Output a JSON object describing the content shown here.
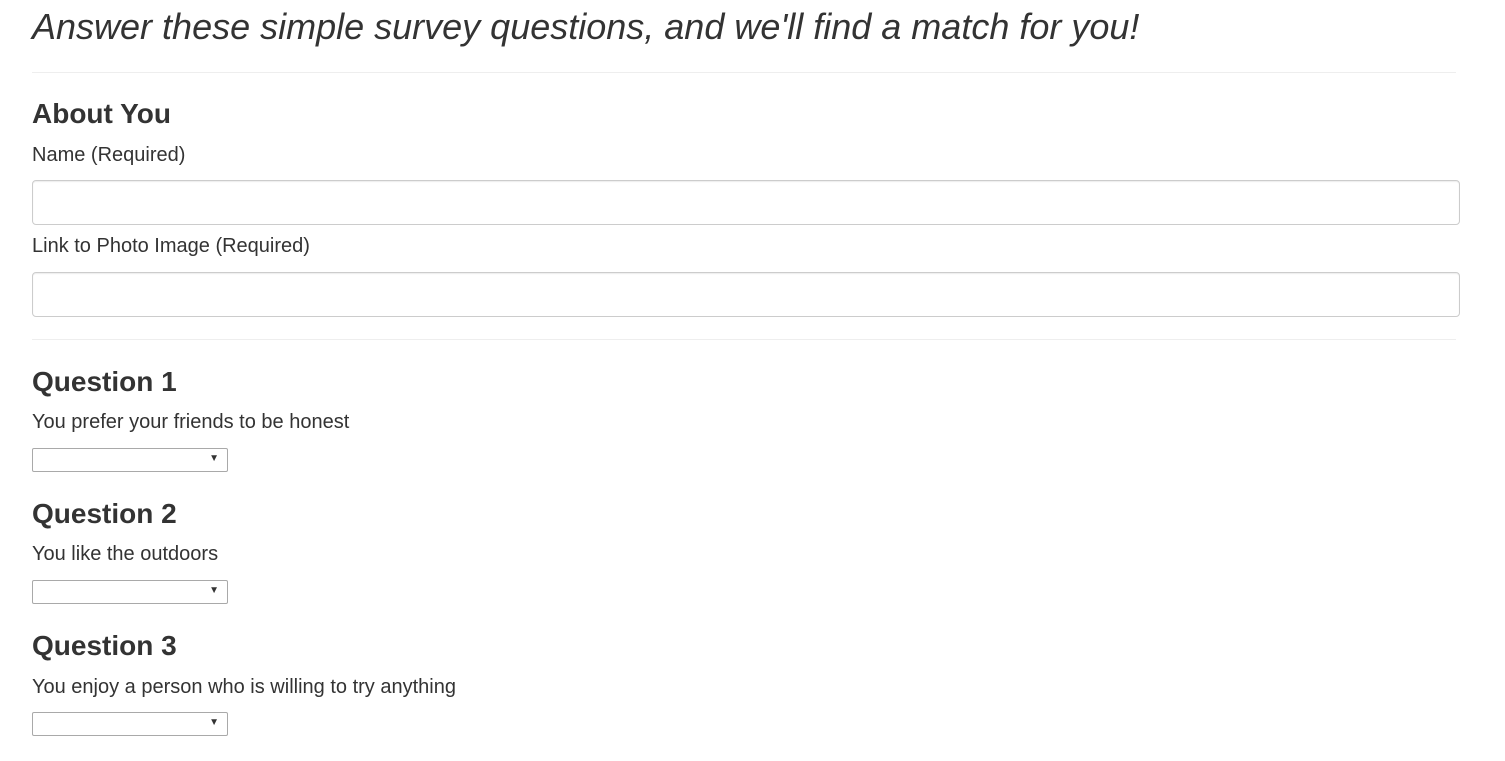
{
  "header": {
    "lead": "Answer these simple survey questions, and we'll find a match for you!"
  },
  "about": {
    "heading": "About You",
    "name_label": "Name (Required)",
    "name_value": "",
    "photo_label": "Link to Photo Image (Required)",
    "photo_value": ""
  },
  "questions": [
    {
      "heading": "Question 1",
      "text": "You prefer your friends to be honest",
      "selected": ""
    },
    {
      "heading": "Question 2",
      "text": "You like the outdoors",
      "selected": ""
    },
    {
      "heading": "Question 3",
      "text": "You enjoy a person who is willing to try anything",
      "selected": ""
    }
  ],
  "icons": {
    "dropdown": "caret-down-icon"
  }
}
